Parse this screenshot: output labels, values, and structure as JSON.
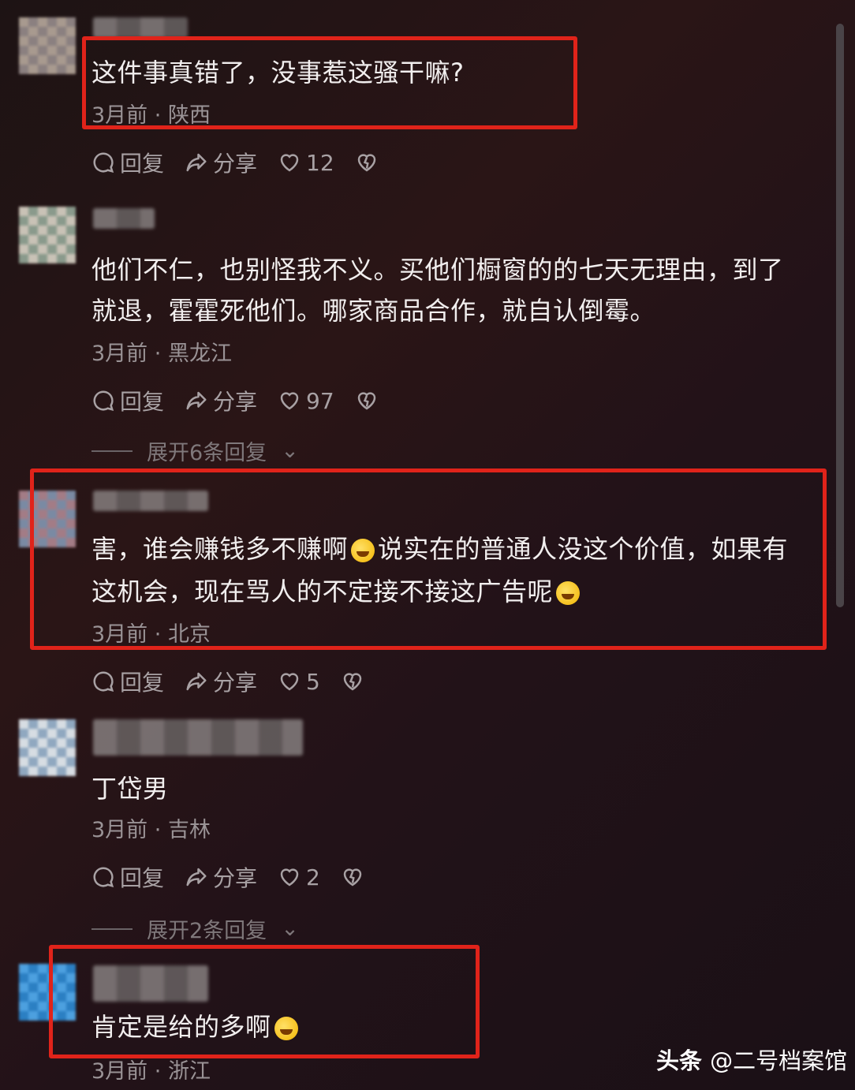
{
  "comments": [
    {
      "text": "这件事真错了，没事惹这骚干嘛?",
      "time": "3月前",
      "location": "陕西",
      "reply": "回复",
      "share": "分享",
      "likes": "12"
    },
    {
      "text_line1": "他们不仁，也别怪我不义。买他们橱窗的的七天无理由，到了",
      "text_line2": "就退，霍霍死他们。哪家商品合作，就自认倒霉。",
      "time": "3月前",
      "location": "黑龙江",
      "reply": "回复",
      "share": "分享",
      "likes": "97",
      "expand": "展开6条回复"
    },
    {
      "text_line1a": "害，谁会赚钱多不赚啊",
      "text_line1b": "说实在的普通人没这个价值，如果有",
      "text_line2": "这机会，现在骂人的不定接不接这广告呢",
      "time": "3月前",
      "location": "北京",
      "reply": "回复",
      "share": "分享",
      "likes": "5"
    },
    {
      "text": "丁岱男",
      "time": "3月前",
      "location": "吉林",
      "reply": "回复",
      "share": "分享",
      "likes": "2",
      "expand": "展开2条回复"
    },
    {
      "text": "肯定是给的多啊",
      "time": "3月前",
      "location": "浙江"
    }
  ],
  "meta_sep": "·",
  "watermark": {
    "brand": "头条",
    "author": "@二号档案馆"
  },
  "colors": {
    "highlight_box": "#e0231a",
    "background": "#241416"
  }
}
